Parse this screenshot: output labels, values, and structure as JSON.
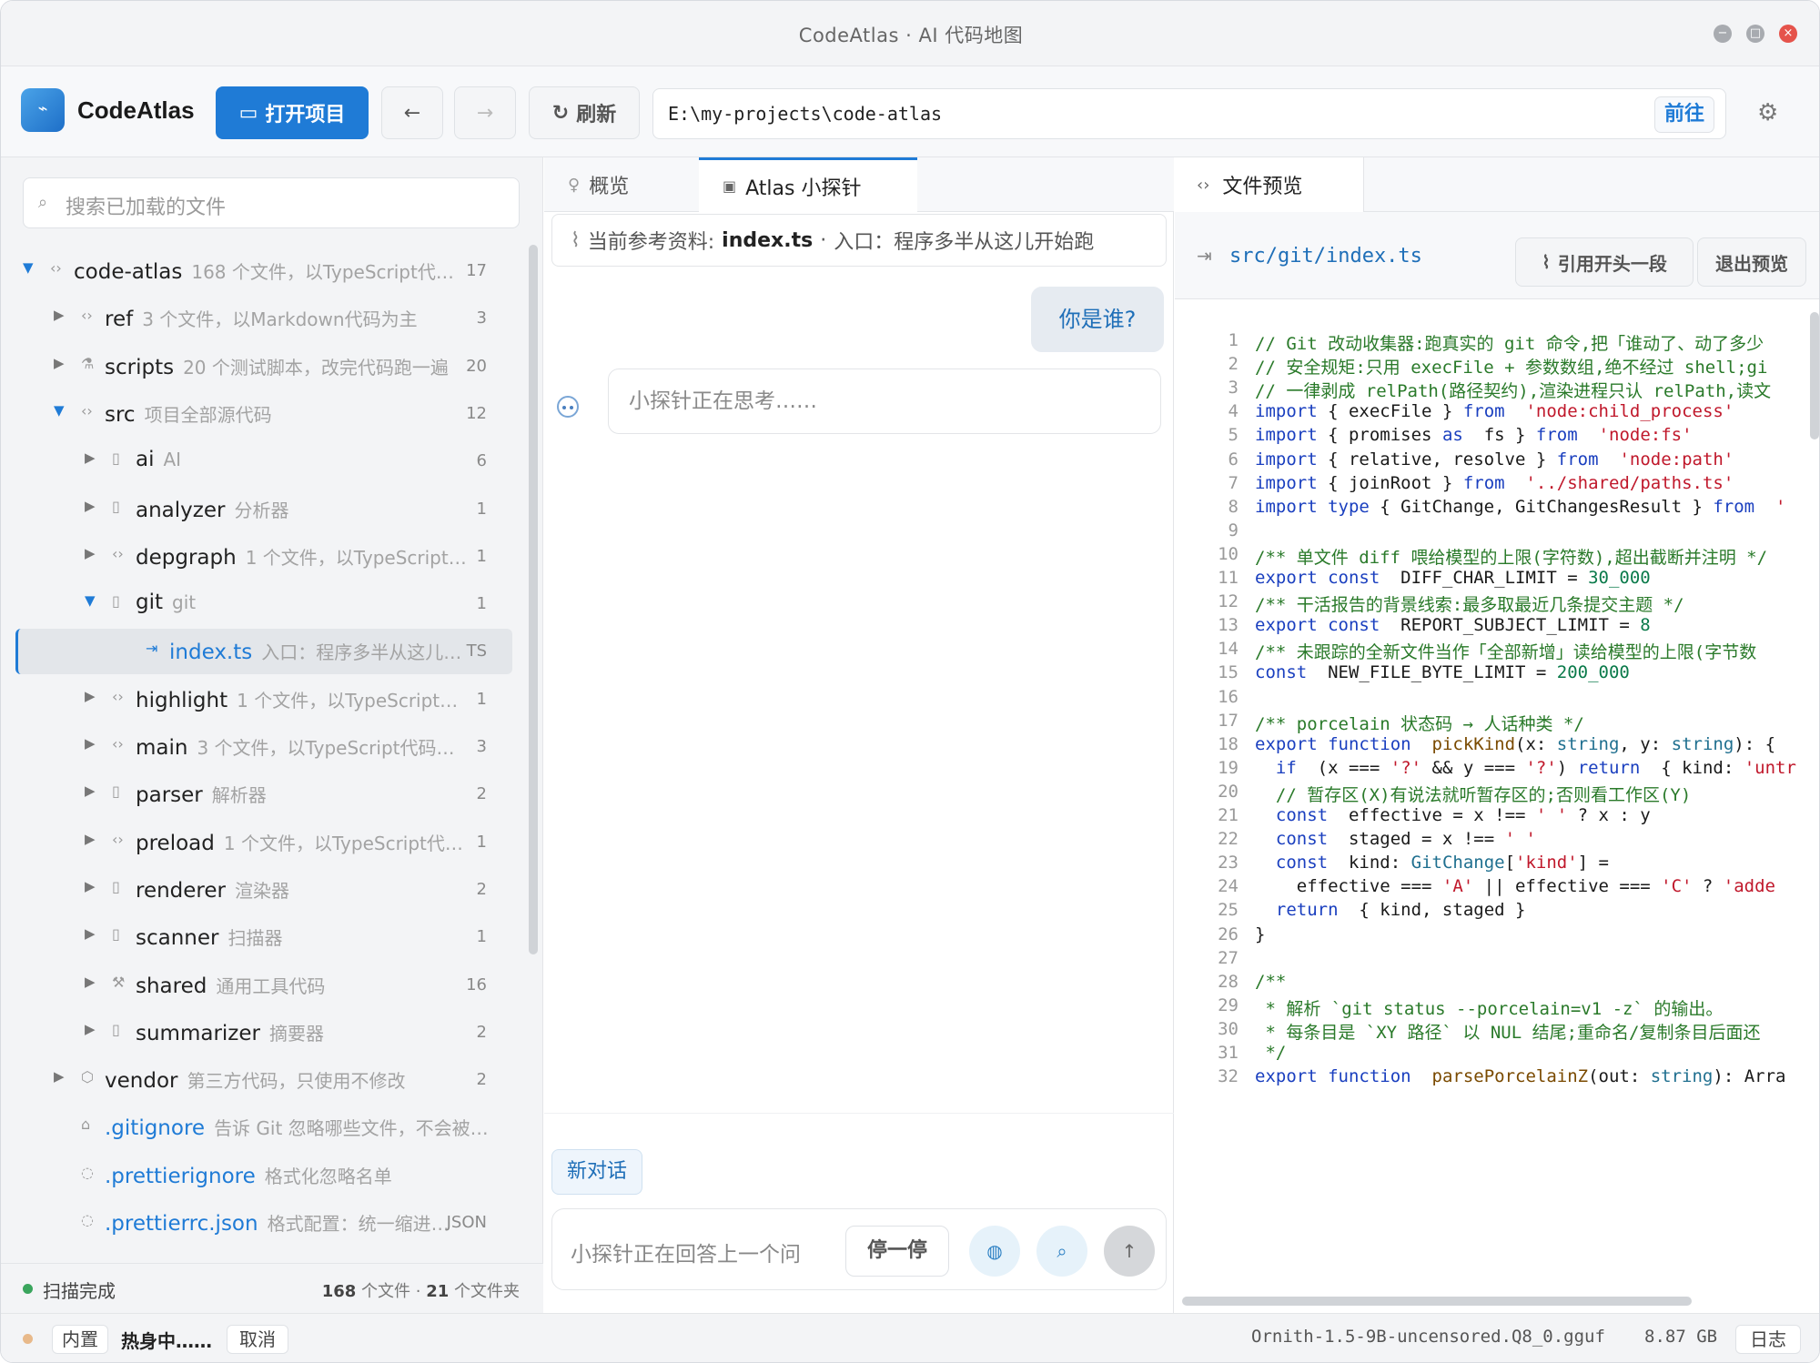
{
  "window": {
    "title": "CodeAtlas · AI 代码地图"
  },
  "toolbar": {
    "brand": "CodeAtlas",
    "open_project": "打开项目",
    "refresh": "刷新",
    "path": "E:\\my-projects\\code-atlas",
    "go": "前往"
  },
  "sidebar": {
    "search_placeholder": "搜索已加载的文件",
    "tree": [
      {
        "name": "code-atlas",
        "desc": "168 个文件，以TypeScript代…",
        "count": "17",
        "level": 0,
        "expanded": true,
        "icon": "code-icon"
      },
      {
        "name": "ref",
        "desc": "3 个文件，以Markdown代码为主",
        "count": "3",
        "level": 1,
        "expanded": false,
        "icon": "code-icon"
      },
      {
        "name": "scripts",
        "desc": "20 个测试脚本，改完代码跑一遍",
        "count": "20",
        "level": 1,
        "expanded": false,
        "icon": "flask-icon"
      },
      {
        "name": "src",
        "desc": "项目全部源代码",
        "count": "12",
        "level": 1,
        "expanded": true,
        "icon": "code-icon"
      },
      {
        "name": "ai",
        "desc": "AI",
        "count": "6",
        "level": 2,
        "expanded": false,
        "icon": "file-icon"
      },
      {
        "name": "analyzer",
        "desc": "分析器",
        "count": "1",
        "level": 2,
        "expanded": false,
        "icon": "file-icon"
      },
      {
        "name": "depgraph",
        "desc": "1 个文件，以TypeScript…",
        "count": "1",
        "level": 2,
        "expanded": false,
        "icon": "code-icon"
      },
      {
        "name": "git",
        "desc": "git",
        "count": "1",
        "level": 2,
        "expanded": true,
        "icon": "file-icon"
      },
      {
        "name": "index.ts",
        "desc": "入口：程序多半从这儿…",
        "count": "TS",
        "level": 3,
        "selected": true,
        "icon": "entry-icon"
      },
      {
        "name": "highlight",
        "desc": "1 个文件，以TypeScript…",
        "count": "1",
        "level": 2,
        "expanded": false,
        "icon": "code-icon"
      },
      {
        "name": "main",
        "desc": "3 个文件，以TypeScript代码…",
        "count": "3",
        "level": 2,
        "expanded": false,
        "icon": "code-icon"
      },
      {
        "name": "parser",
        "desc": "解析器",
        "count": "2",
        "level": 2,
        "expanded": false,
        "icon": "file-icon"
      },
      {
        "name": "preload",
        "desc": "1 个文件，以TypeScript代…",
        "count": "1",
        "level": 2,
        "expanded": false,
        "icon": "code-icon"
      },
      {
        "name": "renderer",
        "desc": "渲染器",
        "count": "2",
        "level": 2,
        "expanded": false,
        "icon": "file-icon"
      },
      {
        "name": "scanner",
        "desc": "扫描器",
        "count": "1",
        "level": 2,
        "expanded": false,
        "icon": "file-icon"
      },
      {
        "name": "shared",
        "desc": "通用工具代码",
        "count": "16",
        "level": 2,
        "expanded": false,
        "icon": "wrench-icon"
      },
      {
        "name": "summarizer",
        "desc": "摘要器",
        "count": "2",
        "level": 2,
        "expanded": false,
        "icon": "file-icon"
      },
      {
        "name": "vendor",
        "desc": "第三方代码，只使用不修改",
        "count": "2",
        "level": 1,
        "expanded": false,
        "icon": "box-icon"
      },
      {
        "name": ".gitignore",
        "desc": "告诉 Git 忽略哪些文件，不会被…",
        "count": "",
        "level": 1,
        "file": true,
        "icon": "lock-icon"
      },
      {
        "name": ".prettierignore",
        "desc": "格式化忽略名单",
        "count": "",
        "level": 1,
        "file": true,
        "icon": "drop-icon"
      },
      {
        "name": ".prettierrc.json",
        "desc": "格式配置：统一缩进…",
        "count": "JSON",
        "level": 1,
        "file": true,
        "icon": "drop-icon"
      }
    ],
    "footer": {
      "status": "扫描完成",
      "files_num": "168",
      "files_label": "个文件",
      "sep": "·",
      "dirs_num": "21",
      "dirs_label": "个文件夹"
    }
  },
  "chat": {
    "tabs": [
      "概览",
      "Atlas 小探针"
    ],
    "ref_label": "当前参考资料:",
    "ref_file": "index.ts",
    "ref_sep": "·",
    "ref_desc": "入口：程序多半从这儿开始跑",
    "user_msg": "你是谁?",
    "bot_msg": "小探针正在思考……",
    "new_chat": "新对话",
    "input_placeholder": "小探针正在回答上一个问",
    "stop": "停一停"
  },
  "preview": {
    "tab": "文件预览",
    "file": "src/git/index.ts",
    "quote_btn": "引用开头一段",
    "exit_btn": "退出预览",
    "lines": [
      [
        [
          "cm",
          "// Git 改动收集器:跑真实的 git 命令,把「谁动了、动了多少"
        ]
      ],
      [
        [
          "cm",
          "// 安全规矩:只用 execFile + 参数数组,绝不经过 shell;gi"
        ]
      ],
      [
        [
          "cm",
          "// 一律剥成 relPath(路径契约),渲染进程只认 relPath,读文"
        ]
      ],
      [
        [
          "kw",
          "import"
        ],
        [
          "",
          "{ execFile } "
        ],
        [
          "kw",
          "from"
        ],
        [
          "",
          " "
        ],
        [
          "str",
          "'node:child_process'"
        ]
      ],
      [
        [
          "kw",
          "import"
        ],
        [
          "",
          "{ promises "
        ],
        [
          "kw",
          "as"
        ],
        [
          "",
          " fs } "
        ],
        [
          "kw",
          "from"
        ],
        [
          "",
          " "
        ],
        [
          "str",
          "'node:fs'"
        ]
      ],
      [
        [
          "kw",
          "import"
        ],
        [
          "",
          "{ relative, resolve } "
        ],
        [
          "kw",
          "from"
        ],
        [
          "",
          " "
        ],
        [
          "str",
          "'node:path'"
        ]
      ],
      [
        [
          "kw",
          "import"
        ],
        [
          "",
          "{ joinRoot } "
        ],
        [
          "kw",
          "from"
        ],
        [
          "",
          " "
        ],
        [
          "str",
          "'../shared/paths.ts'"
        ]
      ],
      [
        [
          "kw",
          "import type"
        ],
        [
          "",
          "{ GitChange, GitChangesResult } "
        ],
        [
          "kw",
          "from"
        ],
        [
          "",
          " "
        ],
        [
          "str",
          "'"
        ]
      ],
      [
        [
          "",
          ""
        ]
      ],
      [
        [
          "cm",
          "/** 单文件 diff 喂给模型的上限(字符数),超出截断并注明 */"
        ]
      ],
      [
        [
          "kw",
          "export const"
        ],
        [
          "",
          " DIFF_CHAR_LIMIT = "
        ],
        [
          "num",
          "30_000"
        ]
      ],
      [
        [
          "cm",
          "/** 干活报告的背景线索:最多取最近几条提交主题 */"
        ]
      ],
      [
        [
          "kw",
          "export const"
        ],
        [
          "",
          " REPORT_SUBJECT_LIMIT = "
        ],
        [
          "num",
          "8"
        ]
      ],
      [
        [
          "cm",
          "/** 未跟踪的全新文件当作「全部新增」读给模型的上限(字节数"
        ]
      ],
      [
        [
          "kw",
          "const"
        ],
        [
          "",
          " NEW_FILE_BYTE_LIMIT = "
        ],
        [
          "num",
          "200_000"
        ]
      ],
      [
        [
          "",
          ""
        ]
      ],
      [
        [
          "cm",
          "/** porcelain 状态码 → 人话种类 */"
        ]
      ],
      [
        [
          "kw",
          "export function"
        ],
        [
          "",
          " "
        ],
        [
          "fn",
          "pickKind"
        ],
        [
          "",
          "(x: "
        ],
        [
          "ty",
          "string"
        ],
        [
          "",
          ", y: "
        ],
        [
          "ty",
          "string"
        ],
        [
          "",
          "): {"
        ]
      ],
      [
        [
          "",
          "  "
        ],
        [
          "kw",
          "if"
        ],
        [
          "",
          " (x === "
        ],
        [
          "str",
          "'?'"
        ],
        [
          "",
          " && y === "
        ],
        [
          "str",
          "'?'"
        ],
        [
          "",
          ") "
        ],
        [
          "kw",
          "return"
        ],
        [
          "",
          " { kind: "
        ],
        [
          "str",
          "'untr"
        ]
      ],
      [
        [
          "",
          "  "
        ],
        [
          "cm",
          "// 暂存区(X)有说法就听暂存区的;否则看工作区(Y)"
        ]
      ],
      [
        [
          "",
          "  "
        ],
        [
          "kw",
          "const"
        ],
        [
          "",
          " effective = x !== "
        ],
        [
          "str",
          "' '"
        ],
        [
          "",
          " ? x : y"
        ]
      ],
      [
        [
          "",
          "  "
        ],
        [
          "kw",
          "const"
        ],
        [
          "",
          " staged = x !== "
        ],
        [
          "str",
          "' '"
        ]
      ],
      [
        [
          "",
          "  "
        ],
        [
          "kw",
          "const"
        ],
        [
          "",
          " kind: "
        ],
        [
          "ty",
          "GitChange"
        ],
        [
          "",
          "["
        ],
        [
          "str",
          "'kind'"
        ],
        [
          "",
          "] ="
        ]
      ],
      [
        [
          "",
          "    effective === "
        ],
        [
          "str",
          "'A'"
        ],
        [
          "",
          " || effective === "
        ],
        [
          "str",
          "'C'"
        ],
        [
          "",
          " ? "
        ],
        [
          "str",
          "'adde"
        ]
      ],
      [
        [
          "",
          "  "
        ],
        [
          "kw",
          "return"
        ],
        [
          "",
          " { kind, staged }"
        ]
      ],
      [
        [
          "",
          "}"
        ]
      ],
      [
        [
          "",
          ""
        ]
      ],
      [
        [
          "cm",
          "/**"
        ]
      ],
      [
        [
          "cm",
          " * 解析 `git status --porcelain=v1 -z` 的输出。"
        ]
      ],
      [
        [
          "cm",
          " * 每条目是 `XY 路径` 以 NUL 结尾;重命名/复制条目后面还"
        ]
      ],
      [
        [
          "cm",
          " */"
        ]
      ],
      [
        [
          "kw",
          "export function"
        ],
        [
          "",
          " "
        ],
        [
          "fn",
          "parsePorcelainZ"
        ],
        [
          "",
          "(out: "
        ],
        [
          "ty",
          "string"
        ],
        [
          "",
          "): Arra"
        ]
      ]
    ]
  },
  "status": {
    "builtin": "内置",
    "warming": "热身中……",
    "cancel": "取消",
    "model": "Ornith-1.5-9B-uncensored.Q8_0.gguf",
    "size": "8.87 GB",
    "log": "日志"
  },
  "colors": {
    "accent": "#1f7bd6",
    "close": "#e5534b",
    "green_dot": "#3aa55d",
    "warm_dot": "#e8b98a"
  }
}
